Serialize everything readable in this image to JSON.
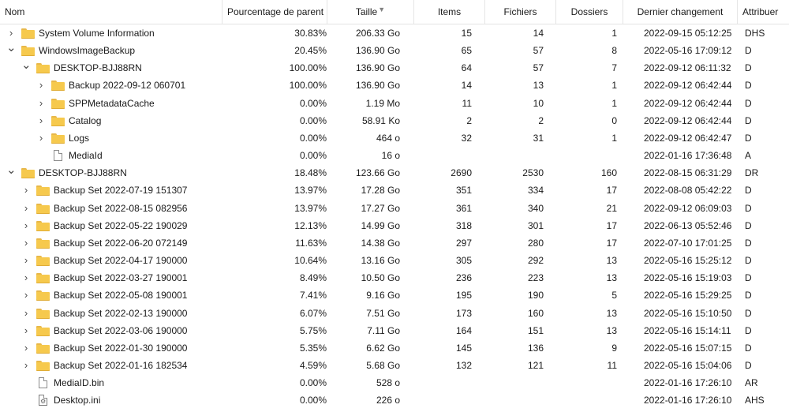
{
  "columns": {
    "name": "Nom",
    "percent": "Pourcentage de parent",
    "size": "Taille",
    "items": "Items",
    "files": "Fichiers",
    "folders": "Dossiers",
    "modified": "Dernier changement",
    "attributes": "Attribuer"
  },
  "rows": [
    {
      "level": 0,
      "expander": "collapsed",
      "icon": "folder-icon",
      "name": "System Volume Information",
      "percent": "30.83%",
      "size": "206.33 Go",
      "items": "15",
      "files": "14",
      "folders": "1",
      "modified": "2022-09-15 05:12:25",
      "attributes": "DHS"
    },
    {
      "level": 0,
      "expander": "expanded",
      "icon": "folder-icon",
      "name": "WindowsImageBackup",
      "percent": "20.45%",
      "size": "136.90 Go",
      "items": "65",
      "files": "57",
      "folders": "8",
      "modified": "2022-05-16 17:09:12",
      "attributes": "D"
    },
    {
      "level": 1,
      "expander": "expanded",
      "icon": "folder-icon",
      "name": "DESKTOP-BJJ88RN",
      "percent": "100.00%",
      "size": "136.90 Go",
      "items": "64",
      "files": "57",
      "folders": "7",
      "modified": "2022-09-12 06:11:32",
      "attributes": "D"
    },
    {
      "level": 2,
      "expander": "collapsed",
      "icon": "folder-icon",
      "name": "Backup 2022-09-12 060701",
      "percent": "100.00%",
      "size": "136.90 Go",
      "items": "14",
      "files": "13",
      "folders": "1",
      "modified": "2022-09-12 06:42:44",
      "attributes": "D"
    },
    {
      "level": 2,
      "expander": "collapsed",
      "icon": "folder-icon",
      "name": "SPPMetadataCache",
      "percent": "0.00%",
      "size": "1.19 Mo",
      "items": "11",
      "files": "10",
      "folders": "1",
      "modified": "2022-09-12 06:42:44",
      "attributes": "D"
    },
    {
      "level": 2,
      "expander": "collapsed",
      "icon": "folder-icon",
      "name": "Catalog",
      "percent": "0.00%",
      "size": "58.91 Ko",
      "items": "2",
      "files": "2",
      "folders": "0",
      "modified": "2022-09-12 06:42:44",
      "attributes": "D"
    },
    {
      "level": 2,
      "expander": "collapsed",
      "icon": "folder-icon",
      "name": "Logs",
      "percent": "0.00%",
      "size": "464 o",
      "items": "32",
      "files": "31",
      "folders": "1",
      "modified": "2022-09-12 06:42:47",
      "attributes": "D"
    },
    {
      "level": 2,
      "expander": "none",
      "icon": "file-icon",
      "name": "MediaId",
      "percent": "0.00%",
      "size": "16 o",
      "items": "",
      "files": "",
      "folders": "",
      "modified": "2022-01-16 17:36:48",
      "attributes": "A"
    },
    {
      "level": 0,
      "expander": "expanded",
      "icon": "folder-icon",
      "name": "DESKTOP-BJJ88RN",
      "percent": "18.48%",
      "size": "123.66 Go",
      "items": "2690",
      "files": "2530",
      "folders": "160",
      "modified": "2022-08-15 06:31:29",
      "attributes": "DR"
    },
    {
      "level": 1,
      "expander": "collapsed",
      "icon": "folder-icon",
      "name": "Backup Set 2022-07-19 151307",
      "percent": "13.97%",
      "size": "17.28 Go",
      "items": "351",
      "files": "334",
      "folders": "17",
      "modified": "2022-08-08 05:42:22",
      "attributes": "D"
    },
    {
      "level": 1,
      "expander": "collapsed",
      "icon": "folder-icon",
      "name": "Backup Set 2022-08-15 082956",
      "percent": "13.97%",
      "size": "17.27 Go",
      "items": "361",
      "files": "340",
      "folders": "21",
      "modified": "2022-09-12 06:09:03",
      "attributes": "D"
    },
    {
      "level": 1,
      "expander": "collapsed",
      "icon": "folder-icon",
      "name": "Backup Set 2022-05-22 190029",
      "percent": "12.13%",
      "size": "14.99 Go",
      "items": "318",
      "files": "301",
      "folders": "17",
      "modified": "2022-06-13 05:52:46",
      "attributes": "D"
    },
    {
      "level": 1,
      "expander": "collapsed",
      "icon": "folder-icon",
      "name": "Backup Set 2022-06-20 072149",
      "percent": "11.63%",
      "size": "14.38 Go",
      "items": "297",
      "files": "280",
      "folders": "17",
      "modified": "2022-07-10 17:01:25",
      "attributes": "D"
    },
    {
      "level": 1,
      "expander": "collapsed",
      "icon": "folder-icon",
      "name": "Backup Set 2022-04-17 190000",
      "percent": "10.64%",
      "size": "13.16 Go",
      "items": "305",
      "files": "292",
      "folders": "13",
      "modified": "2022-05-16 15:25:12",
      "attributes": "D"
    },
    {
      "level": 1,
      "expander": "collapsed",
      "icon": "folder-icon",
      "name": "Backup Set 2022-03-27 190001",
      "percent": "8.49%",
      "size": "10.50 Go",
      "items": "236",
      "files": "223",
      "folders": "13",
      "modified": "2022-05-16 15:19:03",
      "attributes": "D"
    },
    {
      "level": 1,
      "expander": "collapsed",
      "icon": "folder-icon",
      "name": "Backup Set 2022-05-08 190001",
      "percent": "7.41%",
      "size": "9.16 Go",
      "items": "195",
      "files": "190",
      "folders": "5",
      "modified": "2022-05-16 15:29:25",
      "attributes": "D"
    },
    {
      "level": 1,
      "expander": "collapsed",
      "icon": "folder-icon",
      "name": "Backup Set 2022-02-13 190000",
      "percent": "6.07%",
      "size": "7.51 Go",
      "items": "173",
      "files": "160",
      "folders": "13",
      "modified": "2022-05-16 15:10:50",
      "attributes": "D"
    },
    {
      "level": 1,
      "expander": "collapsed",
      "icon": "folder-icon",
      "name": "Backup Set 2022-03-06 190000",
      "percent": "5.75%",
      "size": "7.11 Go",
      "items": "164",
      "files": "151",
      "folders": "13",
      "modified": "2022-05-16 15:14:11",
      "attributes": "D"
    },
    {
      "level": 1,
      "expander": "collapsed",
      "icon": "folder-icon",
      "name": "Backup Set 2022-01-30 190000",
      "percent": "5.35%",
      "size": "6.62 Go",
      "items": "145",
      "files": "136",
      "folders": "9",
      "modified": "2022-05-16 15:07:15",
      "attributes": "D"
    },
    {
      "level": 1,
      "expander": "collapsed",
      "icon": "folder-icon",
      "name": "Backup Set 2022-01-16 182534",
      "percent": "4.59%",
      "size": "5.68 Go",
      "items": "132",
      "files": "121",
      "folders": "11",
      "modified": "2022-05-16 15:04:06",
      "attributes": "D"
    },
    {
      "level": 1,
      "expander": "none",
      "icon": "file-icon",
      "name": "MediaID.bin",
      "percent": "0.00%",
      "size": "528 o",
      "items": "",
      "files": "",
      "folders": "",
      "modified": "2022-01-16 17:26:10",
      "attributes": "AR"
    },
    {
      "level": 1,
      "expander": "none",
      "icon": "settings-file-icon",
      "name": "Desktop.ini",
      "percent": "0.00%",
      "size": "226 o",
      "items": "",
      "files": "",
      "folders": "",
      "modified": "2022-01-16 17:26:10",
      "attributes": "AHS"
    }
  ]
}
